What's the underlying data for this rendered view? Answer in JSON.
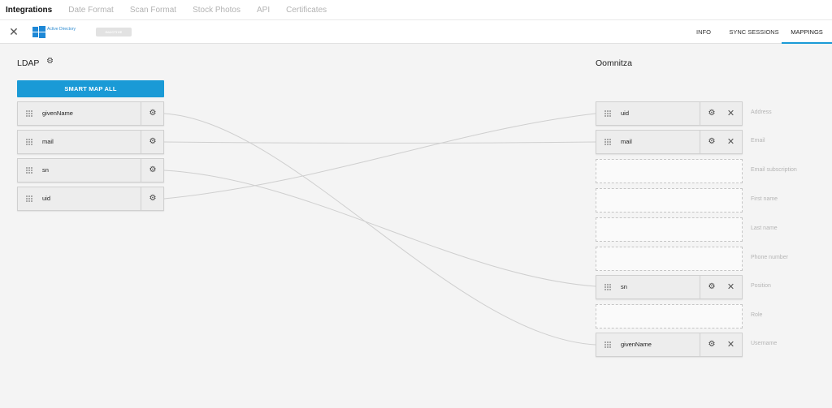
{
  "topnav": {
    "tabs": [
      {
        "label": "Integrations",
        "active": true
      },
      {
        "label": "Date Format",
        "active": false
      },
      {
        "label": "Scan Format",
        "active": false
      },
      {
        "label": "Stock Photos",
        "active": false
      },
      {
        "label": "API",
        "active": false
      },
      {
        "label": "Certificates",
        "active": false
      }
    ]
  },
  "toolbar": {
    "close_icon": "close-icon",
    "integration_name": "Active Directory",
    "status": "INACTIVE",
    "tabs": [
      {
        "label": "INFO",
        "active": false
      },
      {
        "label": "SYNC SESSIONS",
        "active": false
      },
      {
        "label": "MAPPINGS",
        "active": true
      }
    ]
  },
  "ldap": {
    "title": "LDAP",
    "smart_map_label": "SMART MAP ALL",
    "fields": [
      "givenName",
      "mail",
      "sn",
      "uid"
    ]
  },
  "oomnitza": {
    "title": "Oomnitza",
    "rows": [
      {
        "label": "Address",
        "mapped": "uid"
      },
      {
        "label": "Email",
        "mapped": "mail"
      },
      {
        "label": "Email subscription",
        "mapped": ""
      },
      {
        "label": "First name",
        "mapped": ""
      },
      {
        "label": "Last name",
        "mapped": ""
      },
      {
        "label": "Phone number",
        "mapped": ""
      },
      {
        "label": "Position",
        "mapped": "sn"
      },
      {
        "label": "Role",
        "mapped": ""
      },
      {
        "label": "Username",
        "mapped": "givenName"
      }
    ]
  },
  "colors": {
    "accent": "#1a9ad6",
    "line": "#cfcfcf",
    "label": "#b5b5b5"
  }
}
